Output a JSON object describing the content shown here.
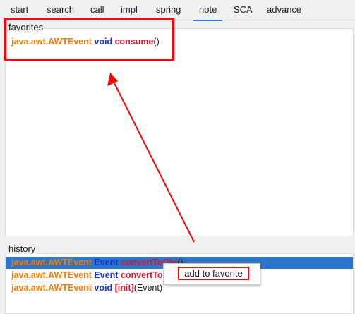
{
  "tabs": [
    {
      "label": "start"
    },
    {
      "label": "search"
    },
    {
      "label": "call"
    },
    {
      "label": "impl"
    },
    {
      "label": "spring"
    },
    {
      "label": "note"
    },
    {
      "label": "SCA"
    },
    {
      "label": "advance"
    }
  ],
  "active_tab": "note",
  "favorites": {
    "title": "favorites",
    "items": [
      {
        "pkg": "java.awt.AWTEvent",
        "type": "void",
        "name": "consume",
        "rest": "()"
      }
    ]
  },
  "history": {
    "title": "history",
    "items": [
      {
        "pkg": "java.awt.AWTEvent",
        "type": "Event",
        "name": "convertToOld",
        "rest": "()",
        "selected": true
      },
      {
        "pkg": "java.awt.AWTEvent",
        "type": "Event",
        "name": "convertTo",
        "rest": "",
        "selected": false
      },
      {
        "pkg": "java.awt.AWTEvent",
        "type": "void",
        "name": "[init]",
        "rest": "(Event)",
        "selected": false
      }
    ]
  },
  "context_menu": {
    "item_label": "add to favorite"
  },
  "colors": {
    "package": "#ef7d0f",
    "keyword": "#1530d6",
    "method": "#d6192c",
    "selection": "#2b74c9",
    "annotation": "#ff0000"
  }
}
